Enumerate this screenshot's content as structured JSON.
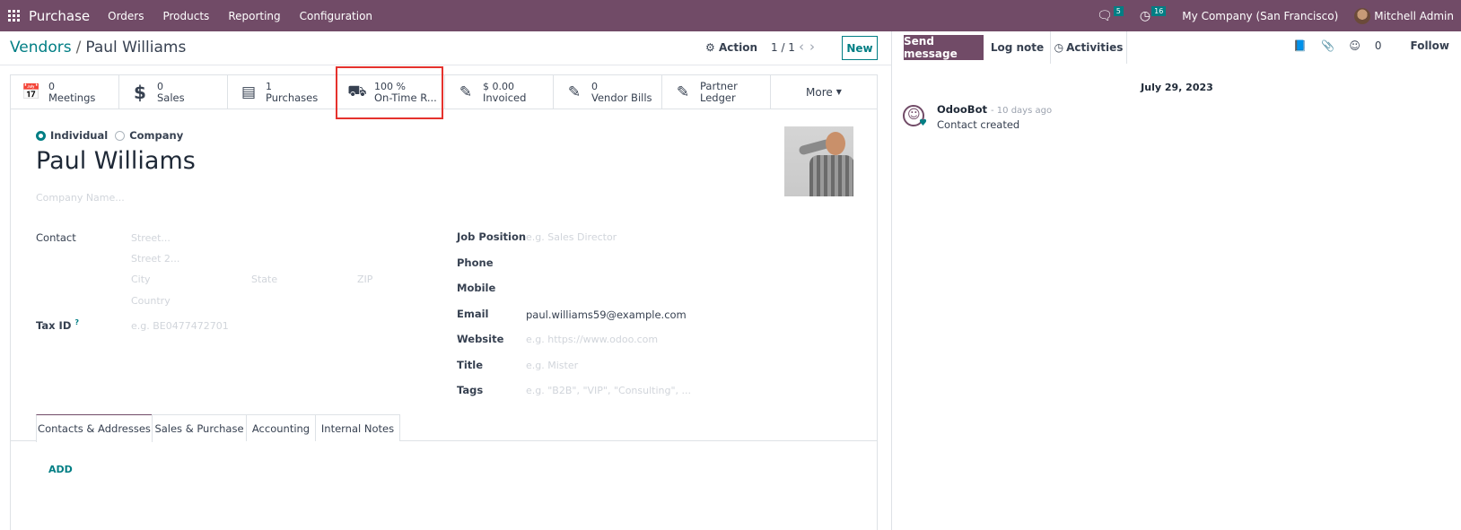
{
  "navbar": {
    "app_name": "Purchase",
    "menu": [
      "Orders",
      "Products",
      "Reporting",
      "Configuration"
    ],
    "messages_count": "5",
    "activities_count": "16",
    "company": "My Company (San Francisco)",
    "user": "Mitchell Admin"
  },
  "control": {
    "breadcrumb_parent": "Vendors",
    "breadcrumb_separator": "/",
    "breadcrumb_current": "Paul Williams",
    "action_label": "Action",
    "pager": "1 / 1",
    "new_label": "New"
  },
  "stat_buttons": [
    {
      "icon": "calendar-icon",
      "value": "0",
      "label": "Meetings"
    },
    {
      "icon": "dollar-icon",
      "value": "0",
      "label": "Sales"
    },
    {
      "icon": "credit-card-icon",
      "value": "1",
      "label": "Purchases"
    },
    {
      "icon": "truck-icon",
      "value": "100 %",
      "label": "On-Time R..."
    },
    {
      "icon": "edit-icon",
      "value": "$ 0.00",
      "label": "Invoiced"
    },
    {
      "icon": "edit-icon",
      "value": "0",
      "label": "Vendor Bills"
    },
    {
      "icon": "edit-icon",
      "value": "Partner",
      "label": "Ledger"
    }
  ],
  "more_label": "More",
  "form": {
    "type_options": [
      "Individual",
      "Company"
    ],
    "type_selected": "Individual",
    "name": "Paul Williams",
    "company_name_placeholder": "Company Name...",
    "contact_label": "Contact",
    "street_placeholder": "Street...",
    "street2_placeholder": "Street 2...",
    "city_placeholder": "City",
    "state_placeholder": "State",
    "zip_placeholder": "ZIP",
    "country_placeholder": "Country",
    "tax_id_label": "Tax ID",
    "tax_id_help": "?",
    "tax_id_placeholder": "e.g. BE0477472701",
    "job_position_label": "Job Position",
    "job_position_placeholder": "e.g. Sales Director",
    "phone_label": "Phone",
    "mobile_label": "Mobile",
    "email_label": "Email",
    "email_value": "paul.williams59@example.com",
    "website_label": "Website",
    "website_placeholder": "e.g. https://www.odoo.com",
    "title_label": "Title",
    "title_placeholder": "e.g. Mister",
    "tags_label": "Tags",
    "tags_placeholder": "e.g. \"B2B\", \"VIP\", \"Consulting\", ..."
  },
  "tabs": [
    "Contacts & Addresses",
    "Sales & Purchase",
    "Accounting",
    "Internal Notes"
  ],
  "active_tab": "Contacts & Addresses",
  "add_label": "ADD",
  "chatter": {
    "send_message": "Send message",
    "log_note": "Log note",
    "activities": "Activities",
    "followers_count": "0",
    "follow": "Follow",
    "date": "July 29, 2023",
    "messages": [
      {
        "author": "OdooBot",
        "time": "- 10 days ago",
        "body": "Contact created"
      }
    ]
  },
  "colors": {
    "brand": "#714b67",
    "accent": "#017e84",
    "highlight": "#e5322d"
  }
}
